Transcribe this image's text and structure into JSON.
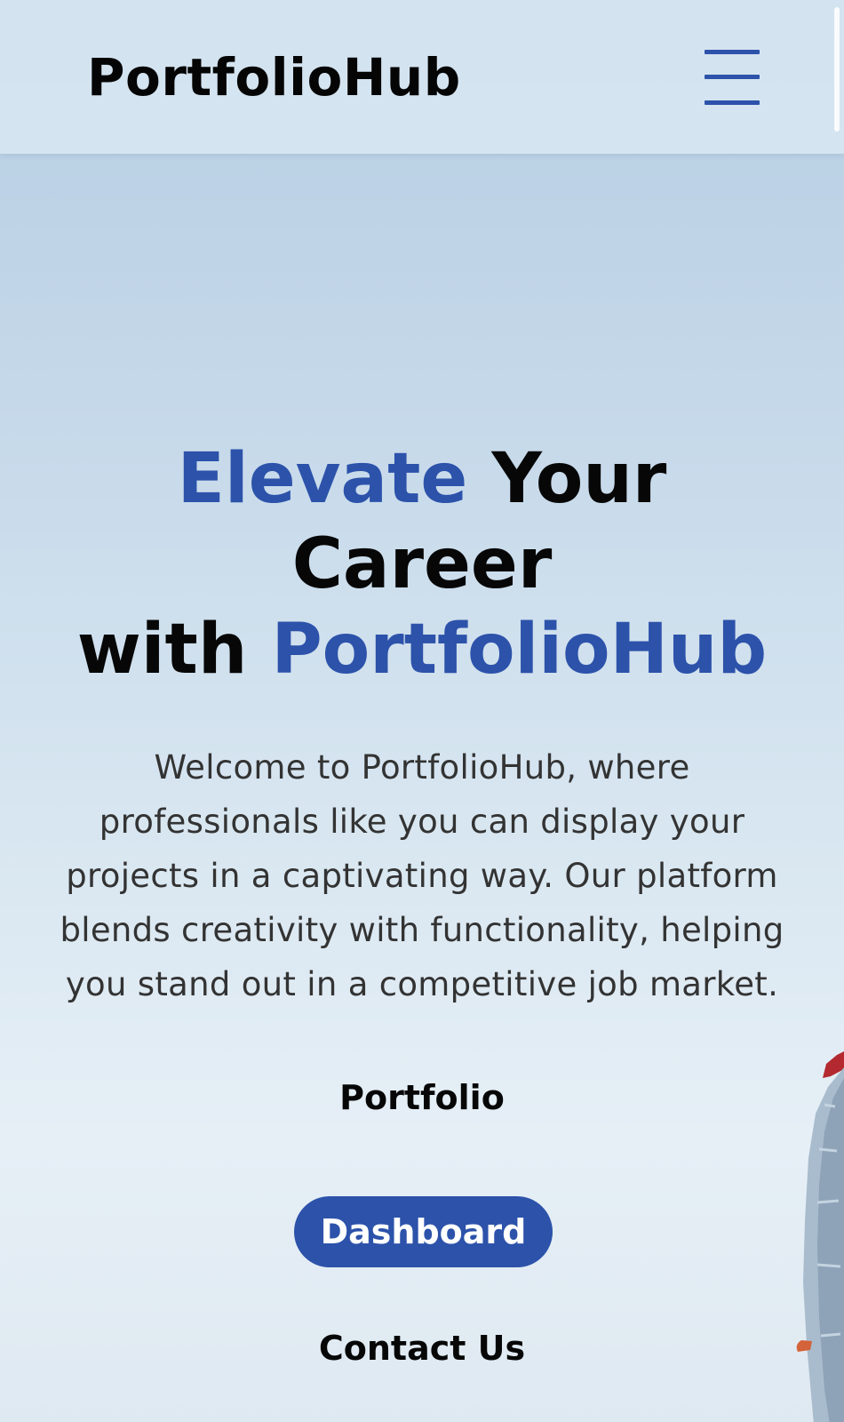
{
  "header": {
    "brand": "PortfolioHub",
    "menu_icon": "hamburger-menu-icon"
  },
  "hero": {
    "headline_part1": "Elevate",
    "headline_part2": "Your Career",
    "headline_part3": "with",
    "headline_part4": "PortfolioHub",
    "intro": "Welcome to PortfolioHub, where professionals like you can display your projects in a captivating way. Our platform blends creativity with functionality, helping you stand out in a competitive job market."
  },
  "nav": {
    "portfolio": "Portfolio",
    "dashboard": "Dashboard",
    "contact": "Contact Us"
  },
  "colors": {
    "accent": "#2c52aa",
    "text": "#070707",
    "body_text": "#333333"
  }
}
